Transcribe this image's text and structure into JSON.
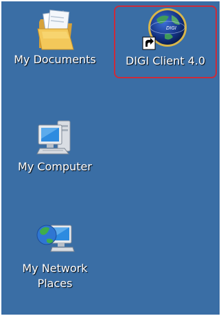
{
  "desktop": {
    "background": "#3a6ea5",
    "selection_color": "#cc2b3a",
    "icons": [
      {
        "label": "My Documents",
        "icon": "folder-documents-icon",
        "selected": false
      },
      {
        "label": "DIGI Client 4.0",
        "icon": "digi-client-globe-icon",
        "shortcut_overlay": "shortcut-arrow-icon",
        "selected": true
      },
      {
        "label": "My Computer",
        "icon": "computer-icon",
        "selected": false
      },
      {
        "label": "My Network Places",
        "icon": "network-places-icon",
        "selected": false
      }
    ]
  }
}
